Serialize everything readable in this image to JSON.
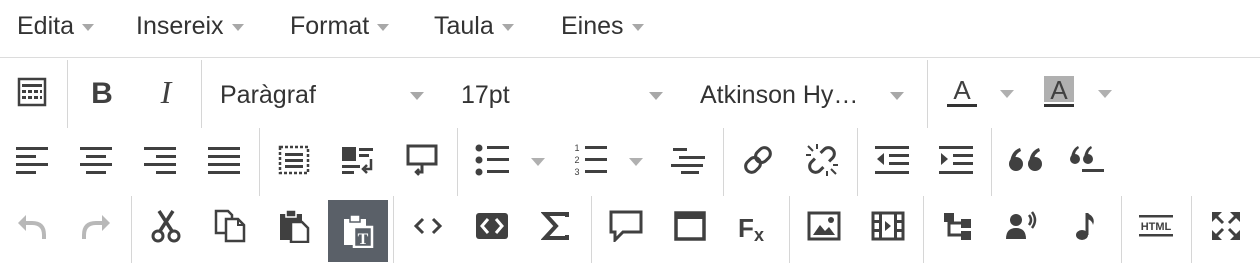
{
  "menubar": {
    "items": [
      {
        "label": "Edita"
      },
      {
        "label": "Insereix"
      },
      {
        "label": "Format"
      },
      {
        "label": "Taula"
      },
      {
        "label": "Eines"
      }
    ]
  },
  "toolbar": {
    "block_format": {
      "value": "Paràgraf"
    },
    "font_size": {
      "value": "17pt"
    },
    "font_family": {
      "value": "Atkinson Hy…"
    },
    "text_color": {
      "glyph": "A",
      "color": "#333333"
    },
    "background_color": {
      "glyph": "A",
      "color": "#b0b0b0"
    },
    "active_button": "paste-as-text-button",
    "colors": {
      "icon": "#404040",
      "icon_disabled": "#b8b8b8",
      "active_bg": "#5a6068",
      "separator": "#d6d6d6"
    }
  }
}
